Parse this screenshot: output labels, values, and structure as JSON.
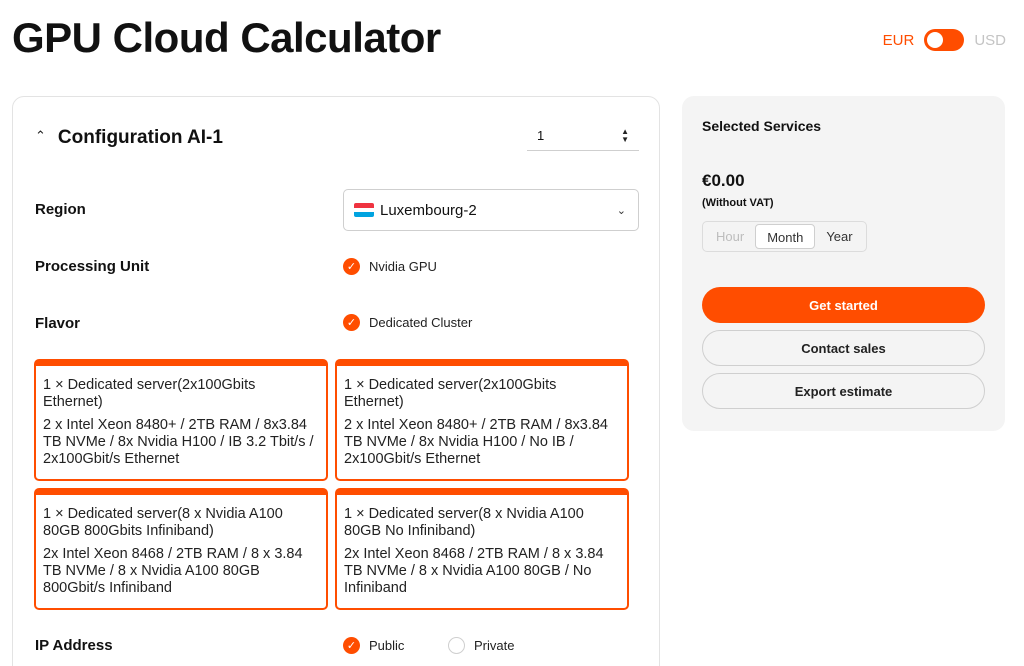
{
  "header": {
    "title": "GPU Cloud Calculator",
    "currency_left": "EUR",
    "currency_right": "USD"
  },
  "config": {
    "title": "Configuration AI-1",
    "quantity": "1",
    "region_label": "Region",
    "region_value": "Luxembourg-2",
    "processing_label": "Processing Unit",
    "processing_value": "Nvidia GPU",
    "flavor_label": "Flavor",
    "flavor_value": "Dedicated Cluster",
    "servers": [
      {
        "title": "1 × Dedicated server(2x100Gbits Ethernet)",
        "spec": "2 x Intel Xeon 8480+ / 2TB RAM / 8x3.84 TB NVMe / 8x Nvidia H100 / IB 3.2 Tbit/s / 2x100Gbit/s Ethernet"
      },
      {
        "title": "1 × Dedicated server(2x100Gbits Ethernet)",
        "spec": "2 x Intel Xeon 8480+ / 2TB RAM / 8x3.84 TB NVMe / 8x Nvidia H100 / No IB / 2x100Gbit/s Ethernet"
      },
      {
        "title": "1 × Dedicated server(8 x Nvidia A100 80GB 800Gbits Infiniband)",
        "spec": "2x Intel Xeon 8468 / 2TB RAM / 8 x 3.84 TB NVMe / 8 x Nvidia A100 80GB 800Gbit/s Infiniband"
      },
      {
        "title": "1 × Dedicated server(8 x Nvidia A100 80GB No Infiniband)",
        "spec": "2x Intel Xeon 8468 / 2TB RAM / 8 x 3.84 TB NVMe / 8 x Nvidia A100 80GB / No Infiniband"
      }
    ],
    "ip_label": "IP Address",
    "ip_public": "Public",
    "ip_private": "Private"
  },
  "summary": {
    "title": "Selected Services",
    "price": "€0.00",
    "vat_note": "(Without VAT)",
    "period_hour": "Hour",
    "period_month": "Month",
    "period_year": "Year",
    "get_started": "Get started",
    "contact_sales": "Contact sales",
    "export_estimate": "Export estimate"
  },
  "colors": {
    "accent": "#ff4d00"
  },
  "icons": {
    "collapse": "chevron-up-icon",
    "stepper": "stepper-arrows-icon",
    "dropdown": "chevron-down-icon",
    "flag": "luxembourg-flag-icon",
    "check": "check-circle-icon"
  }
}
